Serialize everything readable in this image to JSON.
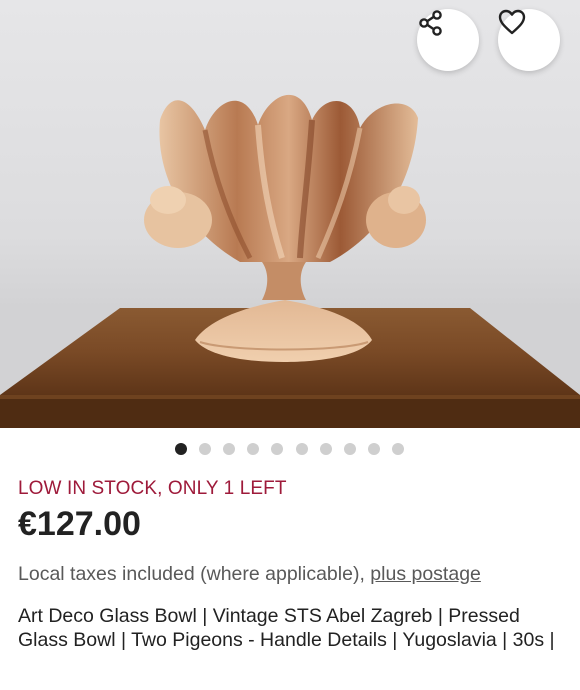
{
  "listing": {
    "stock_notice": "LOW IN STOCK, ONLY 1 LEFT",
    "price": "€127.00",
    "taxes_text": "Local taxes included (where applicable),",
    "postage_link": "plus postage",
    "title": "Art Deco Glass Bowl | Vintage STS Abel Zagreb | Pressed Glass Bowl | Two Pigeons - Handle Details | Yugoslavia | 30s |"
  },
  "gallery": {
    "total_images": 10,
    "active_index": 0
  },
  "icons": {
    "share": "share-icon",
    "favorite": "heart-icon"
  },
  "colors": {
    "stock_accent": "#9e1a3a",
    "active_dot": "#222222",
    "inactive_dot": "#cfcfcf"
  }
}
